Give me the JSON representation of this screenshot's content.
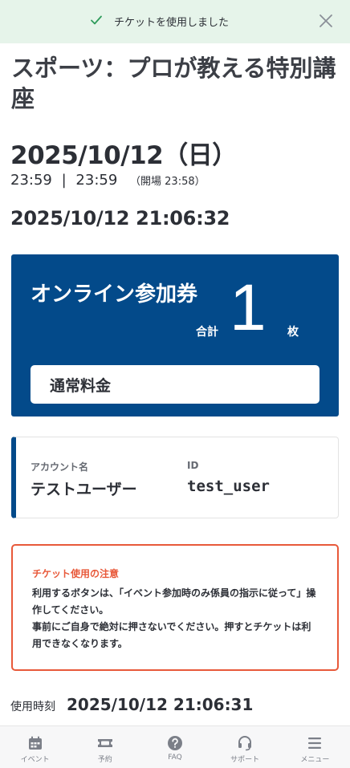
{
  "toast": {
    "message": "チケットを使用しました",
    "icon": "check-icon",
    "close_icon": "close-icon"
  },
  "event": {
    "title": "スポーツ：プロが教える特別講座",
    "date": "2025/10/12",
    "weekday": "（日）",
    "start_time": "23:59",
    "separator": "|",
    "end_time": "23:59",
    "open_time": "（開場 23:58）"
  },
  "current_time": "2025/10/12 21:06:32",
  "ticket": {
    "name": "オンライン参加券",
    "total_label": "合計",
    "count": "1",
    "unit": "枚",
    "fare": "通常料金",
    "color": "#034a8a"
  },
  "account": {
    "name_label": "アカウント名",
    "name_value": "テストユーザー",
    "id_label": "ID",
    "id_value": "test_user"
  },
  "notice": {
    "title": "チケット使用の注意",
    "body_line1": "利用するボタンは、「イベント参加時のみ係員の指示に従って」操作してください。",
    "body_line2": "事前にご自身で絶対に押さないでください。押すとチケットは利用できなくなります。",
    "accent": "#e8593a"
  },
  "used": {
    "label": "使用時刻",
    "time": "2025/10/12 21:06:31"
  },
  "nav": {
    "items": [
      {
        "label": "イベント",
        "icon": "calendar-icon"
      },
      {
        "label": "予約",
        "icon": "ticket-icon"
      },
      {
        "label": "FAQ",
        "icon": "question-icon"
      },
      {
        "label": "サポート",
        "icon": "headset-icon"
      },
      {
        "label": "メニュー",
        "icon": "hamburger-icon"
      }
    ]
  }
}
